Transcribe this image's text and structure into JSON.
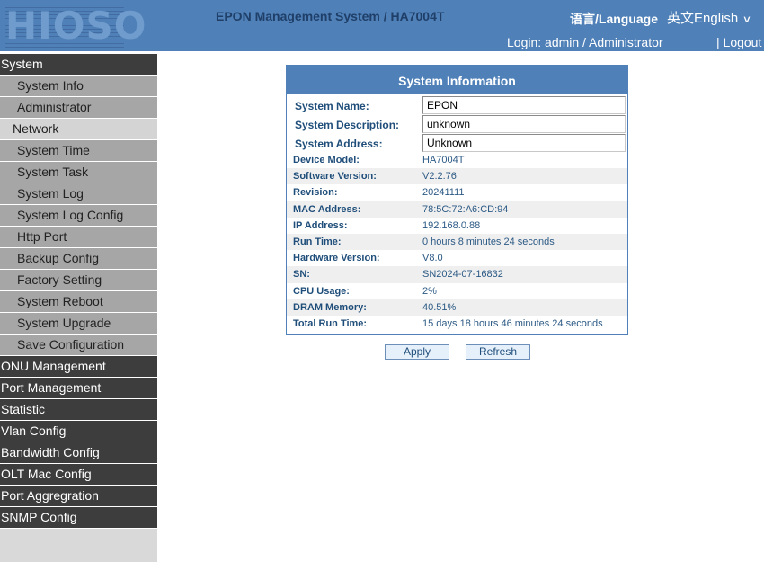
{
  "header": {
    "logo": "HIOSO",
    "title": "EPON Management System / HA7004T",
    "language_label": "语言/Language",
    "language_selected": "英文English",
    "login": "Login: admin / Administrator",
    "logout": "| Logout"
  },
  "sidebar": {
    "items": [
      {
        "label": "System",
        "level": "main"
      },
      {
        "label": "System Info",
        "level": "sub"
      },
      {
        "label": "Administrator",
        "level": "sub"
      },
      {
        "label": "Network",
        "level": "sub",
        "active": true
      },
      {
        "label": "System Time",
        "level": "sub"
      },
      {
        "label": "System Task",
        "level": "sub"
      },
      {
        "label": "System Log",
        "level": "sub"
      },
      {
        "label": "System Log Config",
        "level": "sub"
      },
      {
        "label": "Http Port",
        "level": "sub"
      },
      {
        "label": "Backup Config",
        "level": "sub"
      },
      {
        "label": "Factory Setting",
        "level": "sub"
      },
      {
        "label": "System Reboot",
        "level": "sub"
      },
      {
        "label": "System Upgrade",
        "level": "sub"
      },
      {
        "label": "Save Configuration",
        "level": "sub"
      },
      {
        "label": "ONU Management",
        "level": "main"
      },
      {
        "label": "Port Management",
        "level": "main"
      },
      {
        "label": "Statistic",
        "level": "main"
      },
      {
        "label": "Vlan Config",
        "level": "main"
      },
      {
        "label": "Bandwidth Config",
        "level": "main"
      },
      {
        "label": "OLT Mac Config",
        "level": "main"
      },
      {
        "label": "Port Aggregration",
        "level": "main"
      },
      {
        "label": "SNMP Config",
        "level": "main"
      }
    ]
  },
  "panel": {
    "title": "System Information",
    "fields": [
      {
        "label": "System Name:",
        "value": "EPON"
      },
      {
        "label": "System Description:",
        "value": "unknown"
      },
      {
        "label": "System Address:",
        "value": "Unknown"
      }
    ],
    "info": [
      {
        "label": "Device Model:",
        "value": "HA7004T"
      },
      {
        "label": "Software Version:",
        "value": "V2.2.76"
      },
      {
        "label": "Revision:",
        "value": "20241111"
      },
      {
        "label": "MAC Address:",
        "value": "78:5C:72:A6:CD:94"
      },
      {
        "label": "IP Address:",
        "value": "192.168.0.88"
      },
      {
        "label": "Run Time:",
        "value": "0 hours 8 minutes 24 seconds"
      },
      {
        "label": "Hardware Version:",
        "value": "V8.0"
      },
      {
        "label": "SN:",
        "value": "SN2024-07-16832"
      },
      {
        "label": "CPU Usage:",
        "value": "2%"
      },
      {
        "label": "DRAM Memory:",
        "value": "40.51%"
      },
      {
        "label": "Total Run Time:",
        "value": "15 days 18 hours 46 minutes 24 seconds"
      }
    ]
  },
  "buttons": {
    "apply": "Apply",
    "refresh": "Refresh"
  },
  "colors": {
    "header_bg": "#4f80b8",
    "menu_main_bg": "#3d3d3d",
    "menu_sub_bg": "#a6a6a6",
    "menu_active_bg": "#d4d4d4"
  }
}
